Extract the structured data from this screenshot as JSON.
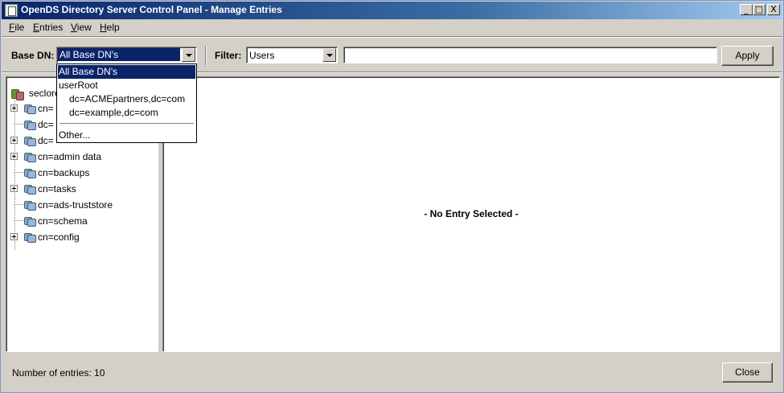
{
  "window": {
    "title": "OpenDS Directory Server Control Panel - Manage Entries",
    "controls": {
      "minimize": "_",
      "maximize": "□",
      "close": "X"
    }
  },
  "menu": [
    "File",
    "Entries",
    "View",
    "Help"
  ],
  "toolbar": {
    "base_dn_label": "Base DN:",
    "base_dn_value": "All Base DN's",
    "filter_label": "Filter:",
    "filter_type": "Users",
    "filter_text": "",
    "apply_label": "Apply"
  },
  "base_dn_dropdown": {
    "options": [
      {
        "label": "All Base DN's",
        "selected": true
      },
      {
        "label": "userRoot"
      },
      {
        "label": "dc=ACMEpartners,dc=com"
      },
      {
        "label": "dc=example,dc=com"
      },
      {
        "label": "Other..."
      }
    ]
  },
  "tree": {
    "root": "seclore",
    "nodes": [
      {
        "label": "cn=",
        "expandable": true
      },
      {
        "label": "dc=",
        "expandable": false
      },
      {
        "label": "dc=",
        "expandable": true
      },
      {
        "label": "cn=admin data",
        "expandable": true
      },
      {
        "label": "cn=backups",
        "expandable": false
      },
      {
        "label": "cn=tasks",
        "expandable": true
      },
      {
        "label": "cn=ads-truststore",
        "expandable": false
      },
      {
        "label": "cn=schema",
        "expandable": false
      },
      {
        "label": "cn=config",
        "expandable": true
      }
    ]
  },
  "detail": {
    "placeholder": "- No Entry Selected -"
  },
  "status": {
    "entries_text": "Number of entries: 10"
  },
  "footer": {
    "close_label": "Close"
  },
  "colors": {
    "selection": "#0a246a",
    "face": "#d4d0c8"
  }
}
